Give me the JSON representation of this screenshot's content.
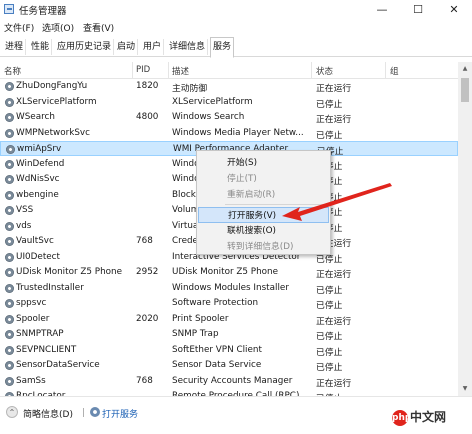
{
  "window": {
    "title": "任务管理器",
    "minimize_glyph": "—",
    "maximize_glyph": "☐",
    "close_glyph": "✕",
    "icon": "task-manager-icon"
  },
  "menubar": [
    "文件(F)",
    "选项(O)",
    "查看(V)"
  ],
  "tabs": [
    {
      "label": "进程",
      "active": false
    },
    {
      "label": "性能",
      "active": false
    },
    {
      "label": "应用历史记录",
      "active": false
    },
    {
      "label": "启动",
      "active": false
    },
    {
      "label": "用户",
      "active": false
    },
    {
      "label": "详细信息",
      "active": false
    },
    {
      "label": "服务",
      "active": true
    }
  ],
  "columns": {
    "name": "名称",
    "pid": "PID",
    "description": "描述",
    "status": "状态",
    "group": "组"
  },
  "rows": [
    {
      "name": "ZhuDongFangYu",
      "pid": "1820",
      "description": "主动防御",
      "status": "正在运行"
    },
    {
      "name": "XLServicePlatform",
      "pid": "",
      "description": "XLServicePlatform",
      "status": "已停止"
    },
    {
      "name": "WSearch",
      "pid": "4800",
      "description": "Windows Search",
      "status": "正在运行"
    },
    {
      "name": "WMPNetworkSvc",
      "pid": "",
      "description": "Windows Media Player Netw...",
      "status": "已停止"
    },
    {
      "name": "wmiApSrv",
      "pid": "",
      "description": "WMI Performance Adapter",
      "status": "已停止",
      "selected": true
    },
    {
      "name": "WinDefend",
      "pid": "",
      "description": "Window",
      "status": "已停止"
    },
    {
      "name": "WdNisSvc",
      "pid": "",
      "description": "Window",
      "status": "已停止"
    },
    {
      "name": "wbengine",
      "pid": "",
      "description": "Block E",
      "status": "已停止"
    },
    {
      "name": "VSS",
      "pid": "",
      "description": "Volume",
      "status": "已停止"
    },
    {
      "name": "vds",
      "pid": "",
      "description": "Virtual",
      "status": "已停止"
    },
    {
      "name": "VaultSvc",
      "pid": "768",
      "description": "Creder",
      "status": "正在运行"
    },
    {
      "name": "UI0Detect",
      "pid": "",
      "description": "Interactive Services Detector",
      "status": "已停止"
    },
    {
      "name": "UDisk Monitor Z5 Phone",
      "pid": "2952",
      "description": "UDisk Monitor Z5 Phone",
      "status": "正在运行"
    },
    {
      "name": "TrustedInstaller",
      "pid": "",
      "description": "Windows Modules Installer",
      "status": "已停止"
    },
    {
      "name": "sppsvc",
      "pid": "",
      "description": "Software Protection",
      "status": "已停止"
    },
    {
      "name": "Spooler",
      "pid": "2020",
      "description": "Print Spooler",
      "status": "正在运行"
    },
    {
      "name": "SNMPTRAP",
      "pid": "",
      "description": "SNMP Trap",
      "status": "已停止"
    },
    {
      "name": "SEVPNCLIENT",
      "pid": "",
      "description": "SoftEther VPN Client",
      "status": "已停止"
    },
    {
      "name": "SensorDataService",
      "pid": "",
      "description": "Sensor Data Service",
      "status": "已停止"
    },
    {
      "name": "SamSs",
      "pid": "768",
      "description": "Security Accounts Manager",
      "status": "正在运行"
    },
    {
      "name": "RpcLocator",
      "pid": "",
      "description": "Remote Procedure Call (RPC)...",
      "status": "已停止"
    }
  ],
  "context_menu": {
    "items": [
      {
        "label": "开始(S)",
        "disabled": false,
        "highlighted": false
      },
      {
        "label": "停止(T)",
        "disabled": true,
        "highlighted": false
      },
      {
        "label": "重新启动(R)",
        "disabled": true,
        "highlighted": false
      },
      {
        "label": "打开服务(V)",
        "disabled": false,
        "highlighted": true
      },
      {
        "label": "联机搜索(O)",
        "disabled": false,
        "highlighted": false
      },
      {
        "label": "转到详细信息(D)",
        "disabled": true,
        "highlighted": false
      }
    ]
  },
  "bottombar": {
    "less_details": "简略信息(D)",
    "less_icon_glyph": "⌃",
    "separator": "|",
    "open_services": "打开服务"
  },
  "scrollbar": {
    "up_glyph": "▲",
    "down_glyph": "▼"
  },
  "watermark": {
    "text": "中文网",
    "logo_text": "php"
  },
  "colors": {
    "selected_row": "#cce8ff",
    "menu_highlight": "#d4e6fa",
    "arrow": "#e0241c",
    "link": "#1a5fb4"
  }
}
